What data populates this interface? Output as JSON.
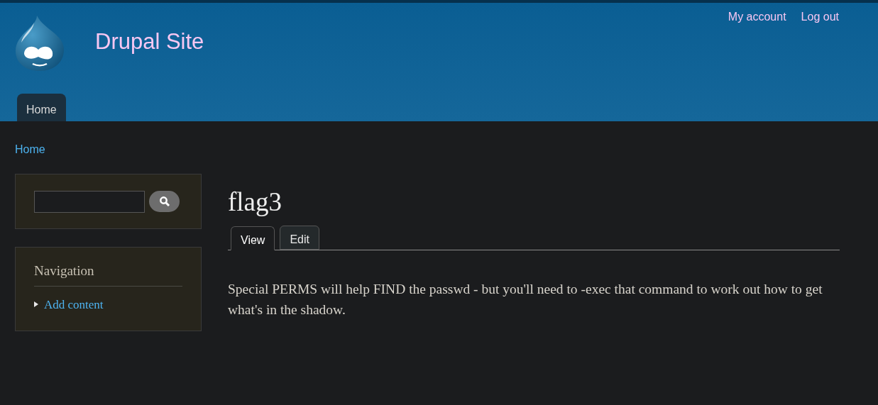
{
  "header": {
    "site_name": "Drupal Site",
    "user_links": [
      "My account",
      "Log out"
    ],
    "main_menu": [
      {
        "label": "Home",
        "selected": true
      }
    ]
  },
  "breadcrumb": [
    "Home"
  ],
  "sidebar": {
    "navigation": {
      "title": "Navigation",
      "items": [
        "Add content"
      ]
    }
  },
  "content": {
    "title": "flag3",
    "tabs": [
      {
        "label": "View",
        "selected": true
      },
      {
        "label": "Edit",
        "selected": false
      }
    ],
    "body": "Special PERMS will help FIND the passwd - but you'll need to -exec that command to work out how to get what's in the shadow."
  }
}
